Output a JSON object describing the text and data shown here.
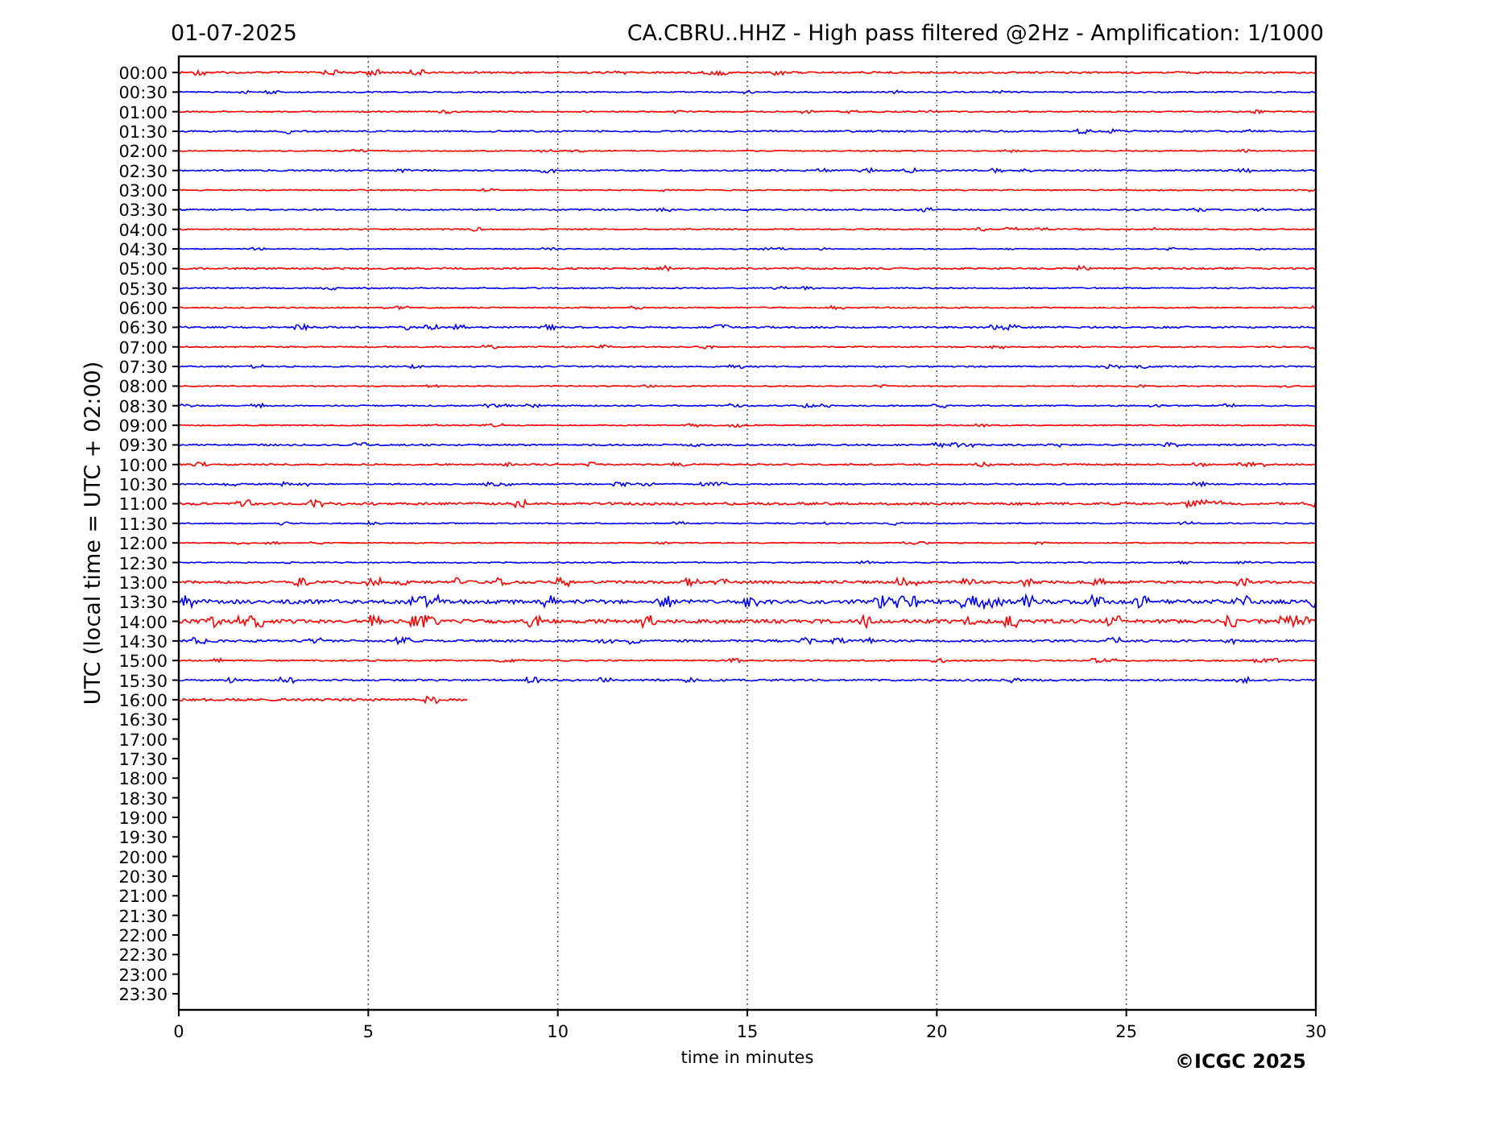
{
  "header": {
    "date": "01-07-2025",
    "title": "CA.CBRU..HHZ - High pass filtered @2Hz - Amplification: 1/1000"
  },
  "plot": {
    "ylabel": "UTC (local time = UTC + 02:00)",
    "xlabel": "time in minutes",
    "row_labels": [
      "00:00",
      "00:30",
      "01:00",
      "01:30",
      "02:00",
      "02:30",
      "03:00",
      "03:30",
      "04:00",
      "04:30",
      "05:00",
      "05:30",
      "06:00",
      "06:30",
      "07:00",
      "07:30",
      "08:00",
      "08:30",
      "09:00",
      "09:30",
      "10:00",
      "10:30",
      "11:00",
      "11:30",
      "12:00",
      "12:30",
      "13:00",
      "13:30",
      "14:00",
      "14:30",
      "15:00",
      "15:30",
      "16:00",
      "16:30",
      "17:00",
      "17:30",
      "18:00",
      "18:30",
      "19:00",
      "19:30",
      "20:00",
      "20:30",
      "21:00",
      "21:30",
      "22:00",
      "22:30",
      "23:00",
      "23:30"
    ],
    "x_ticks": [
      "0",
      "5",
      "10",
      "15",
      "20",
      "25",
      "30"
    ],
    "traces": [
      {
        "color": "#ff0000",
        "level": 1
      },
      {
        "color": "#0000ff",
        "level": 1
      },
      {
        "color": "#ff0000",
        "level": 1
      },
      {
        "color": "#0000ff",
        "level": 1
      },
      {
        "color": "#ff0000",
        "level": 1
      },
      {
        "color": "#0000ff",
        "level": 1
      },
      {
        "color": "#ff0000",
        "level": 1
      },
      {
        "color": "#0000ff",
        "level": 1
      },
      {
        "color": "#ff0000",
        "level": 1
      },
      {
        "color": "#0000ff",
        "level": 1
      },
      {
        "color": "#ff0000",
        "level": 1
      },
      {
        "color": "#0000ff",
        "level": 1
      },
      {
        "color": "#ff0000",
        "level": 1
      },
      {
        "color": "#0000ff",
        "level": 1
      },
      {
        "color": "#ff0000",
        "level": 1
      },
      {
        "color": "#0000ff",
        "level": 1
      },
      {
        "color": "#ff0000",
        "level": 1
      },
      {
        "color": "#0000ff",
        "level": 1
      },
      {
        "color": "#ff0000",
        "level": 1
      },
      {
        "color": "#0000ff",
        "level": 1
      },
      {
        "color": "#ff0000",
        "level": 1
      },
      {
        "color": "#0000ff",
        "level": 1
      },
      {
        "color": "#ff0000",
        "level": 1
      },
      {
        "color": "#0000ff",
        "level": 1
      },
      {
        "color": "#ff0000",
        "level": 1
      },
      {
        "color": "#0000ff",
        "level": 1
      },
      {
        "color": "#ff0000",
        "level": 1
      },
      {
        "color": "#0000ff",
        "level": 1
      },
      {
        "color": "#ff0000",
        "level": 1
      },
      {
        "color": "#0000ff",
        "level": 1
      },
      {
        "color": "#ff0000",
        "level": 1
      },
      {
        "color": "#0000ff",
        "level": 1
      },
      {
        "color": "#ff0000",
        "level": 0.253
      }
    ]
  },
  "copyright": "©ICGC 2025"
}
